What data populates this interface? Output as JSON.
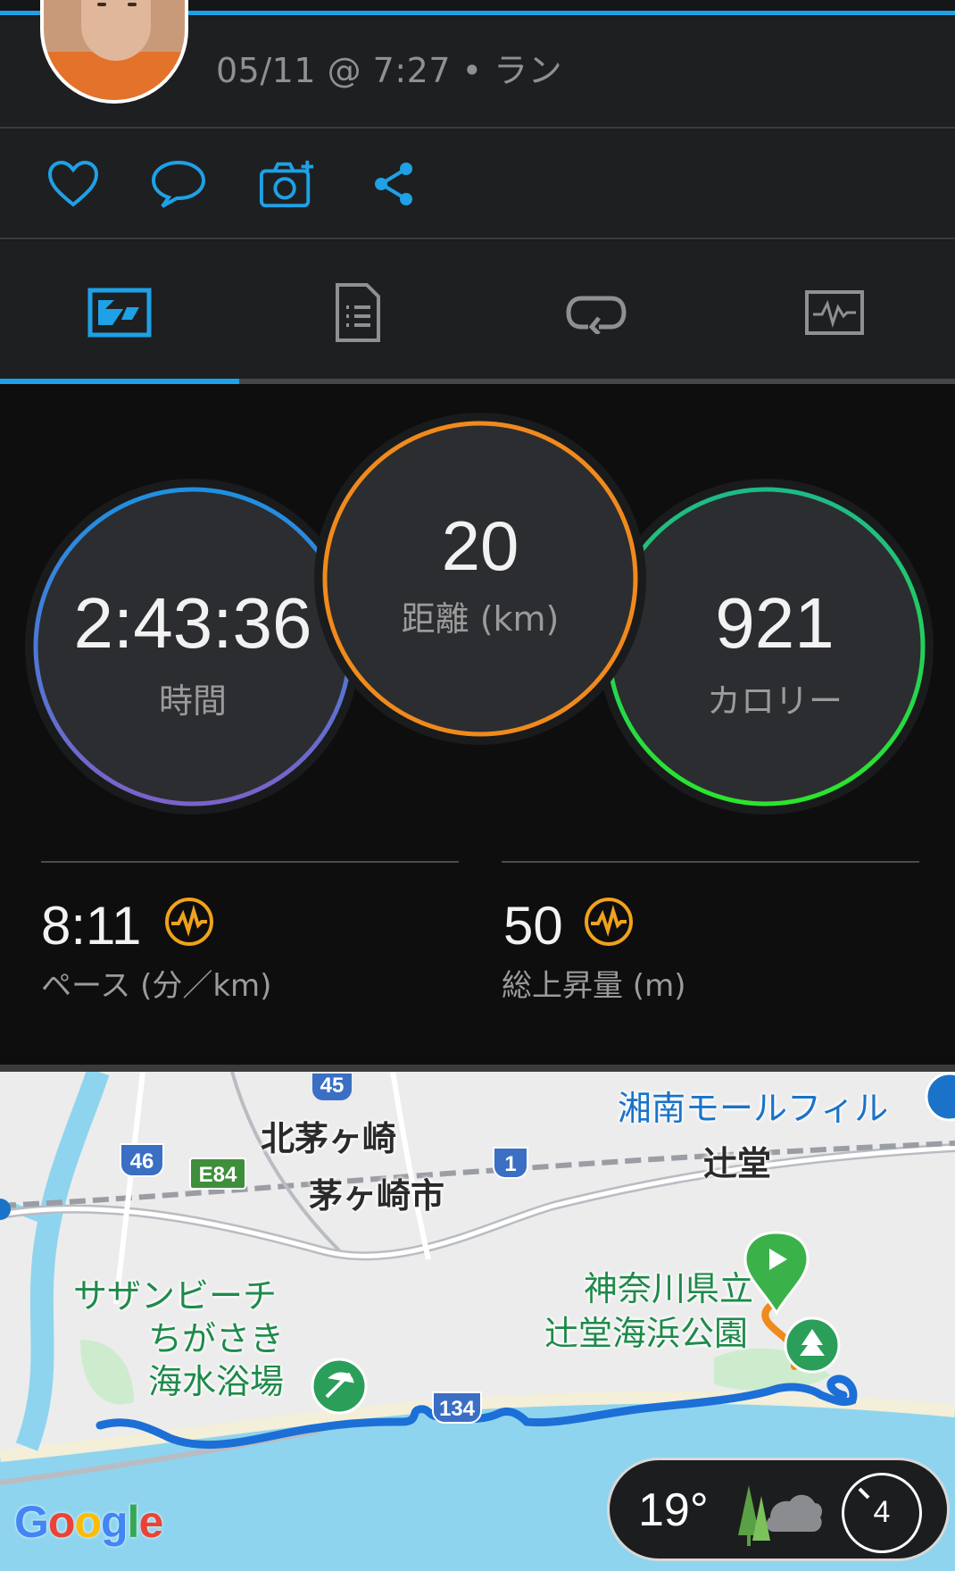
{
  "header": {
    "meta": "05/11 @ 7:27 • ラン"
  },
  "actions": [
    {
      "name": "like",
      "icon": "heart-icon"
    },
    {
      "name": "comment",
      "icon": "comment-icon"
    },
    {
      "name": "add-photo",
      "icon": "camera-plus-icon"
    },
    {
      "name": "share",
      "icon": "share-icon"
    }
  ],
  "tabs": [
    {
      "name": "summary",
      "icon": "summary-icon",
      "active": true
    },
    {
      "name": "details",
      "icon": "document-icon"
    },
    {
      "name": "laps",
      "icon": "laps-icon"
    },
    {
      "name": "charts",
      "icon": "chart-icon"
    }
  ],
  "stats": {
    "time": {
      "value": "2:43:36",
      "label": "時間"
    },
    "distance": {
      "value": "20",
      "label": "距離 (km)"
    },
    "calories": {
      "value": "921",
      "label": "カロリー"
    },
    "pace": {
      "value": "8:11",
      "label": "ペース (分／km)"
    },
    "elevation": {
      "value": "50",
      "label": "総上昇量 (m)"
    }
  },
  "colors": {
    "accent": "#1ea1e6",
    "time_ring_start": "#1e90e0",
    "time_ring_end": "#7b62c9",
    "distance_ring": "#f08a1c",
    "calories_ring_start": "#1eb98a",
    "calories_ring_end": "#2be52b",
    "route": "#1c6fd6"
  },
  "map": {
    "labels": {
      "kita_chigasaki": "北茅ヶ崎",
      "chigasaki_city": "茅ヶ崎市",
      "tsujido": "辻堂",
      "shonan_mall": "湘南モールフィル",
      "beach_line1": "サザンビーチ",
      "beach_line2": "ちがさき",
      "beach_line3": "海水浴場",
      "park_line1": "神奈川県立",
      "park_line2": "辻堂海浜公園"
    },
    "route_shields": {
      "r45": "45",
      "r46": "46",
      "e84": "E84",
      "r1": "1",
      "r134": "134"
    },
    "google": "Google"
  },
  "weather": {
    "temp": "19°",
    "icon": "forest-cloud-icon",
    "wind": "4"
  }
}
